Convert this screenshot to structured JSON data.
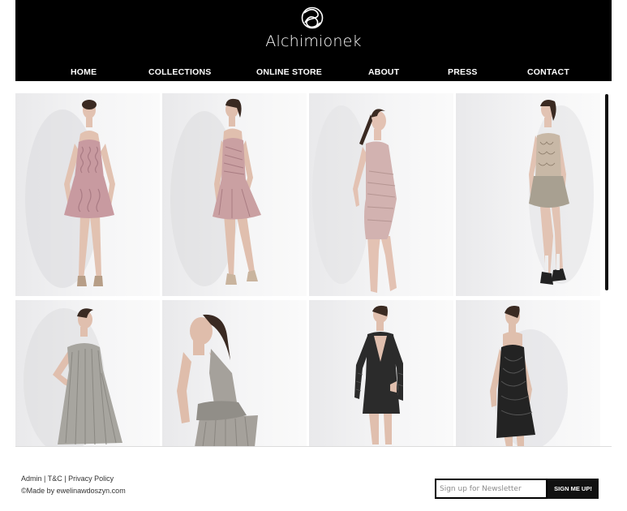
{
  "brand": {
    "name": "Alchimionek"
  },
  "nav": {
    "items": [
      {
        "label": "HOME"
      },
      {
        "label": "COLLECTIONS"
      },
      {
        "label": "ONLINE STORE"
      },
      {
        "label": "ABOUT"
      },
      {
        "label": "PRESS"
      },
      {
        "label": "CONTACT"
      }
    ]
  },
  "gallery": {
    "photos": [
      {
        "dress": "blush ruffled strapless mini dress",
        "color": "#c89aa0"
      },
      {
        "dress": "blush draped strapless dress with tulle skirt",
        "color": "#caa0a2"
      },
      {
        "dress": "pale pink ruched bodycon dress",
        "color": "#d2b2b0"
      },
      {
        "dress": "lace bustier dress with silver skirt",
        "color": "#c8b8a6"
      },
      {
        "dress": "silver pleated strapless dress",
        "color": "#a7a59f"
      },
      {
        "dress": "silver halter open-back dress",
        "color": "#a5a19b"
      },
      {
        "dress": "black lace long-sleeve cutout dress",
        "color": "#2b2b2b"
      },
      {
        "dress": "black draped strapless dress",
        "color": "#232323"
      }
    ]
  },
  "footer": {
    "admin_label": "Admin",
    "tc_label": "T&C",
    "privacy_label": "Privacy Policy",
    "credit": "©Made by ewelinawdoszyn.com",
    "newsletter_placeholder": "Sign up for Newsletter",
    "signup_label": "SIGN ME UP!"
  }
}
